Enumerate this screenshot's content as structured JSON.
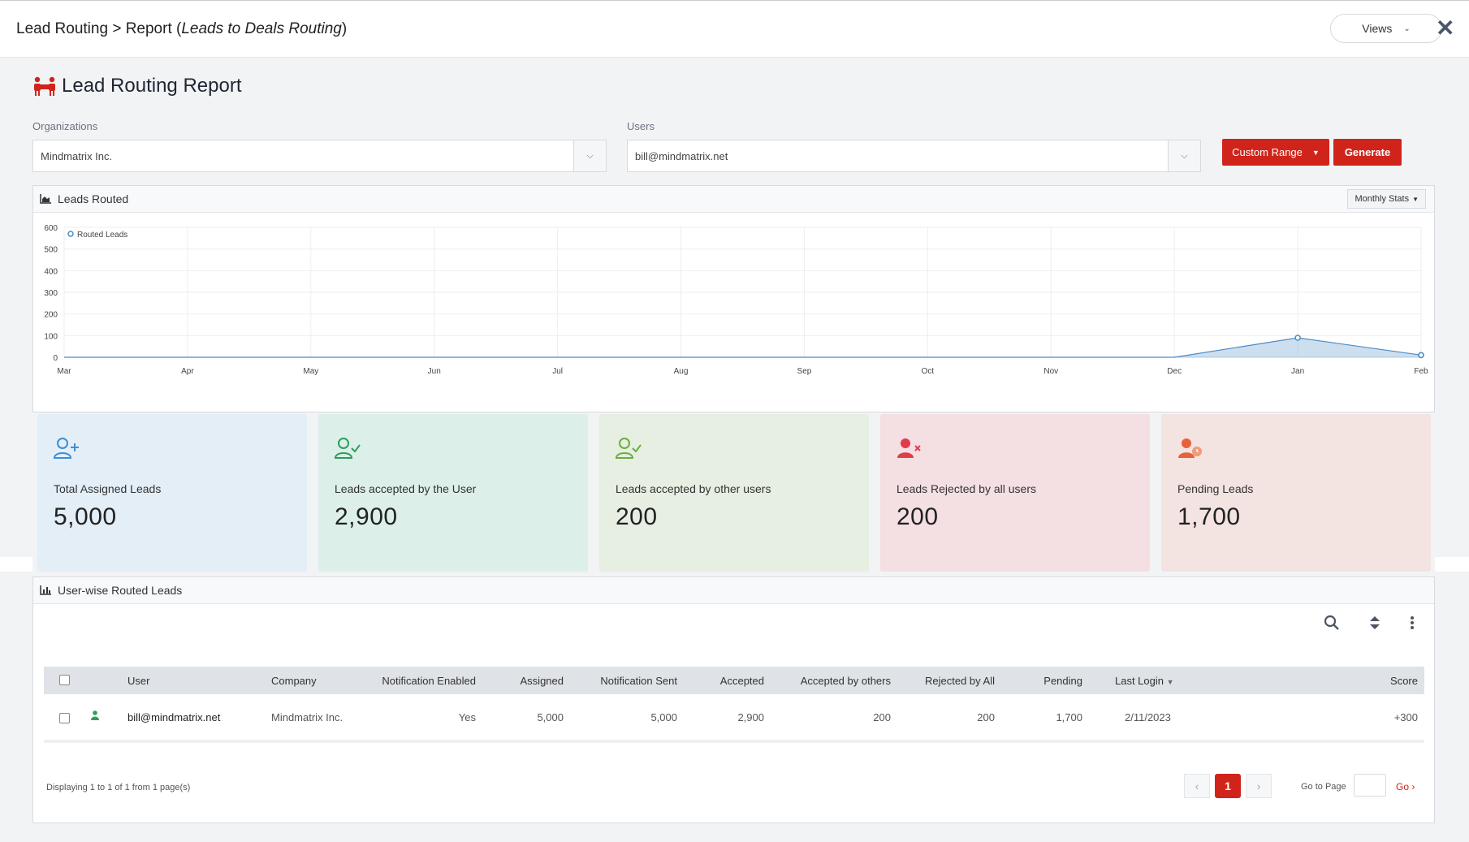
{
  "header": {
    "breadcrumb_prefix": "Lead Routing > Report (",
    "breadcrumb_italic": "Leads to Deals Routing",
    "breadcrumb_suffix": ")",
    "views_label": "Views",
    "close_glyph": "✕"
  },
  "report": {
    "title": "Lead Routing Report"
  },
  "filters": {
    "organizations_label": "Organizations",
    "organizations_value": "Mindmatrix Inc.",
    "users_label": "Users",
    "users_value": "bill@mindmatrix.net",
    "custom_range_label": "Custom Range",
    "generate_label": "Generate"
  },
  "chart_panel": {
    "title": "Leads Routed",
    "stats_dropdown": "Monthly Stats"
  },
  "chart_data": {
    "type": "area",
    "title": "",
    "xlabel": "",
    "ylabel": "",
    "x": [
      "Mar",
      "Apr",
      "May",
      "Jun",
      "Jul",
      "Aug",
      "Sep",
      "Oct",
      "Nov",
      "Dec",
      "Jan",
      "Feb"
    ],
    "ylim": [
      0,
      600
    ],
    "yticks": [
      0,
      100,
      200,
      300,
      400,
      500,
      600
    ],
    "series": [
      {
        "name": "Routed Leads",
        "values": [
          0,
          0,
          0,
          0,
          0,
          0,
          0,
          0,
          0,
          0,
          90,
          10
        ]
      }
    ],
    "legend": "top-left",
    "grid": true,
    "color": "#4a8cc7"
  },
  "cards": [
    {
      "label": "Total Assigned Leads",
      "value": "5,000",
      "icon": "user-plus-icon",
      "bg": "#e3eef7",
      "icon_color": "#3b8fd6"
    },
    {
      "label": "Leads accepted by the User",
      "value": "2,900",
      "icon": "user-check-icon",
      "bg": "#dcefe9",
      "icon_color": "#2e9e5b"
    },
    {
      "label": "Leads accepted by other users",
      "value": "200",
      "icon": "user-check-icon",
      "bg": "#e6efe2",
      "icon_color": "#6cae3c"
    },
    {
      "label": "Leads Rejected by all users",
      "value": "200",
      "icon": "user-x-icon",
      "bg": "#f4dfe3",
      "icon_color": "#e23b4a"
    },
    {
      "label": "Pending Leads",
      "value": "1,700",
      "icon": "user-clock-icon",
      "bg": "#f3e3e1",
      "icon_color": "#e8613a"
    }
  ],
  "table_panel": {
    "title": "User-wise Routed Leads",
    "columns": [
      "User",
      "Company",
      "Notification Enabled",
      "Assigned",
      "Notification Sent",
      "Accepted",
      "Accepted by others",
      "Rejected by All",
      "Pending",
      "Last Login",
      "Score"
    ],
    "rows": [
      {
        "user": "bill@mindmatrix.net",
        "company": "Mindmatrix Inc.",
        "notification_enabled": "Yes",
        "assigned": "5,000",
        "notification_sent": "5,000",
        "accepted": "2,900",
        "accepted_by_others": "200",
        "rejected_by_all": "200",
        "pending": "1,700",
        "last_login": "2/11/2023",
        "score": "+300"
      }
    ],
    "footer": "Displaying 1 to 1 of 1 from 1 page(s)",
    "current_page": "1",
    "goto_label": "Go to Page",
    "go_label": "Go"
  }
}
